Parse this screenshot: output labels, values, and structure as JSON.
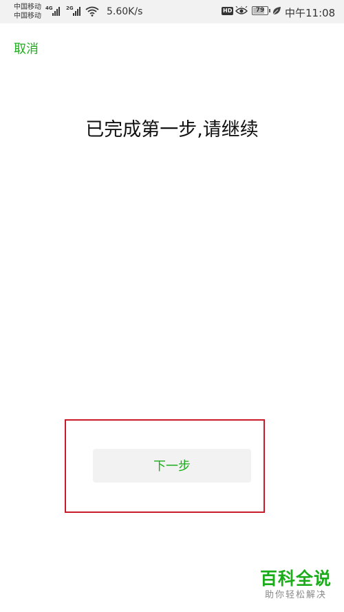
{
  "status_bar": {
    "carrier_1": "中国移动",
    "carrier_2": "中国移动",
    "signal_1_type": "4G",
    "signal_2_type": "2G",
    "network_speed": "5.60K/s",
    "hd_badge": "HD",
    "battery_level": "79",
    "battery_fraction": 0.79,
    "time": "中午11:08",
    "icons": [
      "signal-icon",
      "wifi-icon",
      "eye-icon",
      "battery-icon",
      "leaf-icon"
    ]
  },
  "header": {
    "cancel_label": "取消"
  },
  "main": {
    "title": "已完成第一步,请继续",
    "next_button_label": "下一步"
  },
  "watermark": {
    "brand": "百科全说",
    "slogan": "助你轻松解决"
  },
  "colors": {
    "accent_green": "#1aad19",
    "highlight_red": "#c8192a",
    "status_bar_bg": "#f2f2f2",
    "button_bg": "#f2f2f2"
  }
}
